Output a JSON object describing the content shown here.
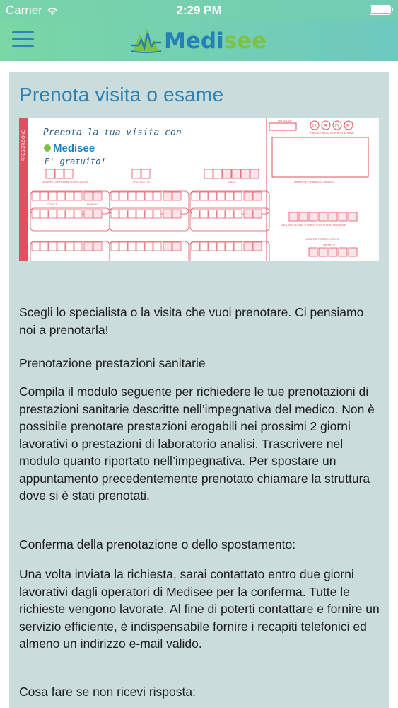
{
  "status_bar": {
    "carrier": "Carrier",
    "time": "2:29 PM"
  },
  "app": {
    "logo_part1": "Medi",
    "logo_part2": "see",
    "brand_green": "#7cc243",
    "brand_blue": "#2680b8"
  },
  "page": {
    "title": "Prenota visita o esame",
    "form_image": {
      "prescrizione": "PRESCRIZIONE",
      "handwriting_line1": "Prenota la tua visita con",
      "handwriting_logo": "Medisee",
      "handwriting_line3": "E' gratuito!",
      "header_letters": [
        "U",
        "B",
        "D",
        "P"
      ],
      "nota_cup": "NOTA CUP",
      "priorita": "PRIORITÀ DELLA PRESTAZIONE",
      "timbro": "TIMBRO E FIRMA DEL MEDICO",
      "data": "DATA",
      "codice": "CODICE",
      "numero": "NUMERO",
      "data_spedizione": "DATA SPEDIZIONE / TIMBRO STRUTTURA EROGANTE",
      "numero_progressivo": "NUMERO PROGRESSIVO",
      "importi": "IMPORTI",
      "tipo_ricetta": "TIPO RICETTA",
      "codice_esenzione": "NUMERO CONFEZIONI / PRESTAZIONI"
    },
    "paragraphs": [
      "Scegli lo specialista o la visita che vuoi prenotare. Ci pensiamo noi a prenotarla!",
      "Prenotazione prestazioni sanitarie",
      "Compila il modulo seguente per richiedere le tue prenotazioni di prestazioni sanitarie descritte nell’impegnativa del medico. Non è possibile prenotare prestazioni erogabili nei prossimi 2 giorni lavorativi o prestazioni di laboratorio analisi. Trascrivere nel modulo quanto riportato nell’impegnativa. Per spostare un appuntamento precedentemente prenotato chiamare la struttura dove si è stati prenotati.",
      "Conferma della prenotazione o dello spostamento:",
      "Una volta inviata la richiesta, sarai contattato entro due giorni lavorativi dagli operatori di Medisee per la conferma. Tutte le richieste vengono lavorate. Al fine di poterti contattare e fornire un servizio efficiente, è indispensabile fornire i recapiti telefonici ed almeno un indirizzo e-mail valido.",
      "Cosa fare se non ricevi risposta:"
    ]
  }
}
